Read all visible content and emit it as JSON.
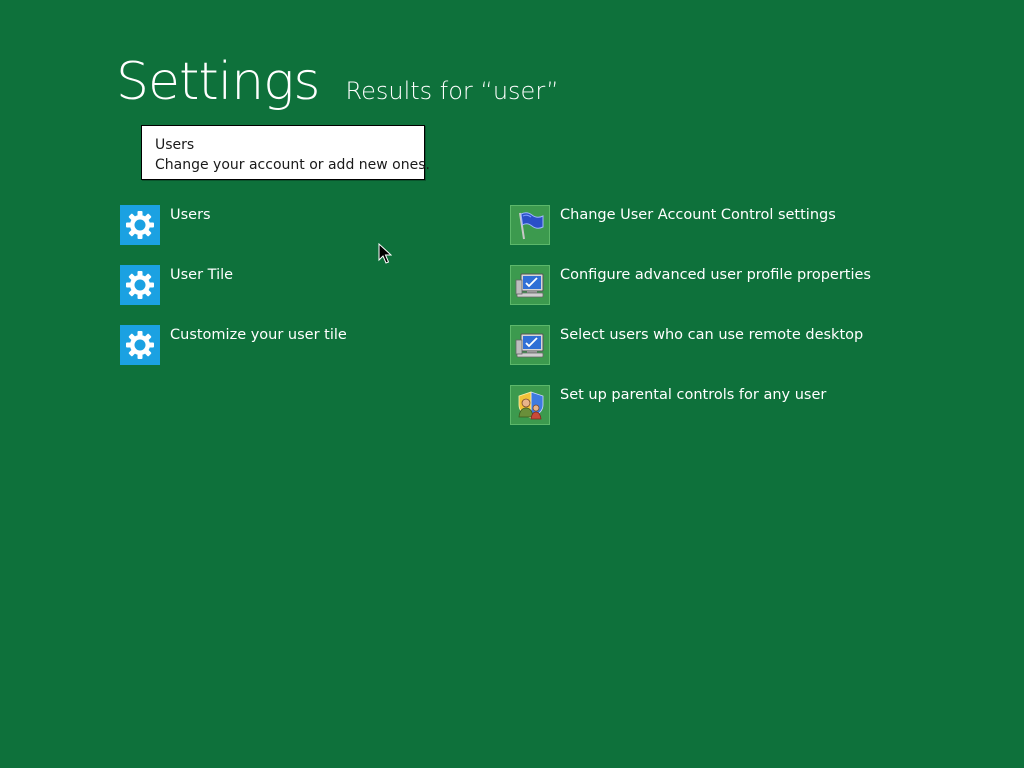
{
  "header": {
    "title": "Settings",
    "subtitle": "Results for “user”"
  },
  "tooltip": {
    "title": "Users",
    "description": "Change your account or add new ones."
  },
  "results_left": [
    {
      "label": "Users",
      "icon": "gear-icon"
    },
    {
      "label": "User Tile",
      "icon": "gear-icon"
    },
    {
      "label": "Customize your user tile",
      "icon": "gear-icon"
    }
  ],
  "results_right": [
    {
      "label": "Change User Account Control settings",
      "icon": "flag-icon"
    },
    {
      "label": "Configure advanced user profile properties",
      "icon": "computer-icon"
    },
    {
      "label": "Select users who can use remote desktop",
      "icon": "computer-icon"
    },
    {
      "label": "Set up parental controls for any user",
      "icon": "parental-controls-icon"
    }
  ],
  "colors": {
    "background": "#0e713b",
    "gear_tile": "#1ba1e2",
    "panel_tile": "#3c9a4e"
  }
}
